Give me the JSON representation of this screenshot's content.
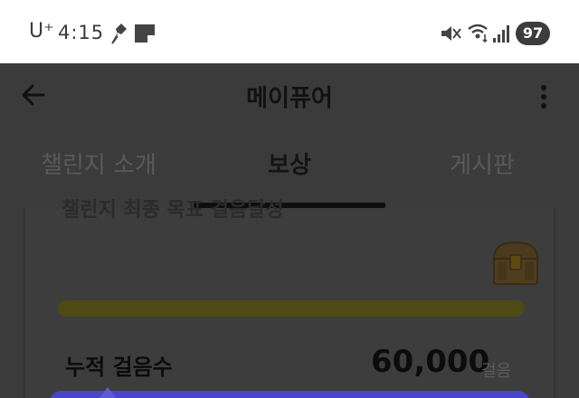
{
  "status_bar": {
    "carrier": "U⁺",
    "time": "4:15",
    "battery": "97",
    "icons": [
      "pin-icon",
      "note-icon",
      "mute-icon",
      "wifi-icon",
      "signal-icon"
    ]
  },
  "app_bar": {
    "title": "메이퓨어",
    "back_icon": "arrow-left-icon",
    "more_icon": "more-vertical-icon"
  },
  "tabs": [
    {
      "label": "챌린지 소개",
      "active": false
    },
    {
      "label": "보상",
      "active": true
    },
    {
      "label": "게시판",
      "active": false
    }
  ],
  "card": {
    "heading": "챌린지 최종 목표 걸음달성",
    "chest_icon": "treasure-chest-icon",
    "progress_percent": 100,
    "stat_label": "누적 걸음수",
    "stat_value": "60,000",
    "stat_unit": "걸음"
  },
  "colors": {
    "overlay": "#3b3b3b",
    "progress": "#4f4916",
    "bottom_panel": "#4a46c8"
  }
}
